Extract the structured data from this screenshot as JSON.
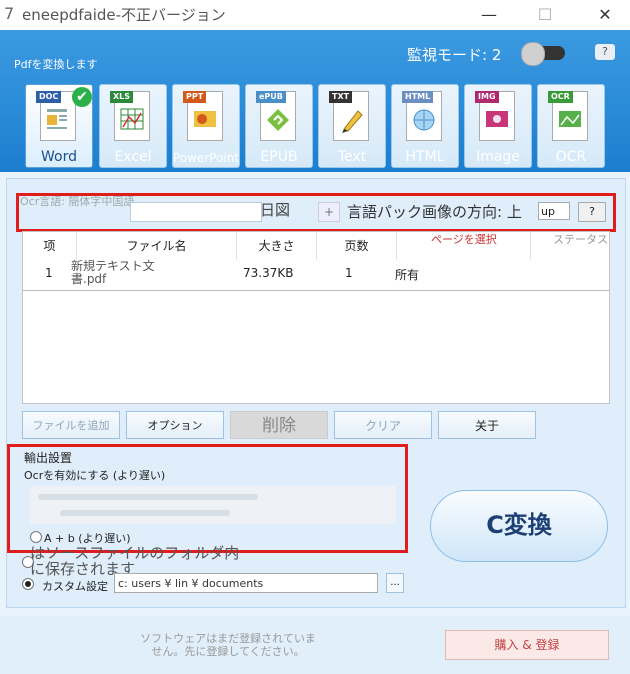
{
  "window": {
    "title": "eneepdfaide-不正バージョン",
    "logo_char": "7",
    "minimize": "—",
    "maximize": "☐",
    "close": "✕"
  },
  "header": {
    "convert_label": "Pdfを変換します",
    "monitor_mode": "監視モード: 2",
    "help": "?"
  },
  "formats": [
    {
      "tag": "DOC",
      "label": "Word",
      "tag_color": "#2d5fa8",
      "active": true
    },
    {
      "tag": "XLS",
      "label": "Excel",
      "tag_color": "#2a8a3a"
    },
    {
      "tag": "PPT",
      "label": "PowerPoint",
      "tag_color": "#d3591b"
    },
    {
      "tag": "ePUB",
      "label": "EPUB",
      "tag_color": "#4a8fc8"
    },
    {
      "tag": "TXT",
      "label": "Text",
      "tag_color": "#333333"
    },
    {
      "tag": "HTML",
      "label": "HTML",
      "tag_color": "#6a8fc0"
    },
    {
      "tag": "IMG",
      "label": "Image",
      "tag_color": "#b0286e"
    },
    {
      "tag": "OCR",
      "label": "OCR",
      "tag_color": "#3a9a3a"
    }
  ],
  "ocr_bar": {
    "lang_label": "Ocr言語: 簡体字中国語",
    "selected": "日図",
    "plus": "+",
    "direction_label": "言語パック画像の方向: 上",
    "direction_value": "up",
    "help": "?"
  },
  "table": {
    "headers": [
      "项",
      "ファイル名",
      "大きさ",
      "页数",
      "ページを選択",
      "ステータス"
    ],
    "rows": [
      {
        "index": "1",
        "filename": "新規テキスト文書.pdf",
        "size": "73.37KB",
        "pages": "1",
        "select": "所有",
        "status": ""
      }
    ]
  },
  "buttons": {
    "add_file": "ファイルを追加",
    "options": "オプション",
    "delete": "削除",
    "clear": "クリア",
    "about": "关于"
  },
  "output": {
    "title": "輸出設置",
    "ocr_enable": "Ocrを有効にする (より遅い)",
    "ab_option": "A + b (より遅い)",
    "source_folder": "はソースファイルのフォルダ内に保存されます",
    "custom_label": "カスタム設定",
    "custom_path": "c: users ¥ lin ¥ documents",
    "browse": "..."
  },
  "convert_button": "C変換",
  "footer": {
    "notice": "ソフトウェアはまだ登録されていません。先に登録してください。",
    "buy": "購入 & 登録"
  }
}
